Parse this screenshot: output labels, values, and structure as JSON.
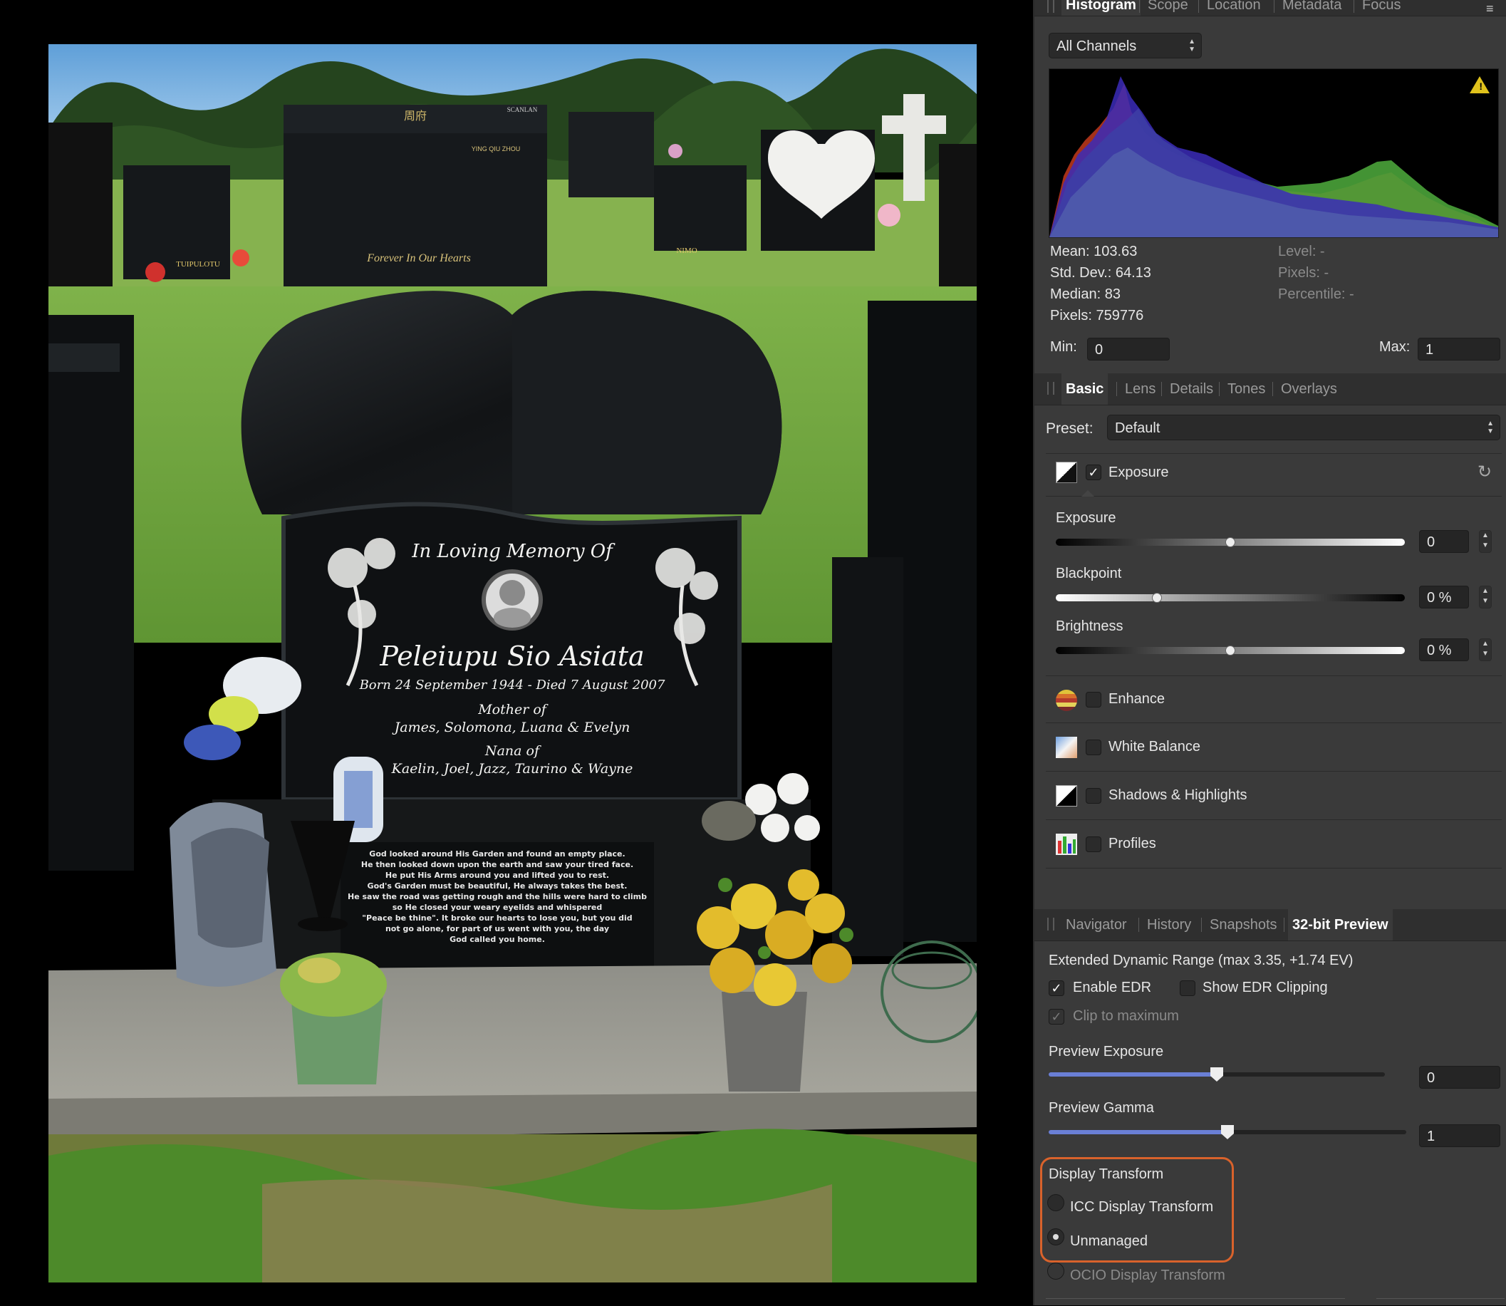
{
  "histogram_panel": {
    "tabs": [
      "Histogram",
      "Scope",
      "Location",
      "Metadata",
      "Focus"
    ],
    "active_tab": "Histogram",
    "channel_select": "All Channels",
    "stats": {
      "mean": "Mean: 103.63",
      "std_dev": "Std. Dev.: 64.13",
      "median": "Median: 83",
      "pixels": "Pixels: 759776",
      "level": "Level: -",
      "pixels_right": "Pixels: -",
      "percentile": "Percentile: -"
    },
    "min_label": "Min:",
    "min_value": "0",
    "max_label": "Max:",
    "max_value": "1"
  },
  "develop_panel": {
    "tabs": [
      "Basic",
      "Lens",
      "Details",
      "Tones",
      "Overlays"
    ],
    "active_tab": "Basic",
    "preset_label": "Preset:",
    "preset_value": "Default",
    "exposure_group": {
      "title": "Exposure",
      "enabled": true,
      "sliders": [
        {
          "label": "Exposure",
          "value": "0",
          "position": 0.5
        },
        {
          "label": "Blackpoint",
          "value": "0 %",
          "position": 0.29
        },
        {
          "label": "Brightness",
          "value": "0 %",
          "position": 0.5
        }
      ]
    },
    "groups": [
      {
        "title": "Enhance",
        "icon": "enhance-icon"
      },
      {
        "title": "White Balance",
        "icon": "white-balance-icon"
      },
      {
        "title": "Shadows & Highlights",
        "icon": "shadows-highlights-icon"
      },
      {
        "title": "Profiles",
        "icon": "profiles-icon"
      }
    ]
  },
  "preview_panel": {
    "tabs": [
      "Navigator",
      "History",
      "Snapshots",
      "32-bit Preview"
    ],
    "active_tab": "32-bit Preview",
    "edr_title": "Extended Dynamic Range (max 3.35, +1.74 EV)",
    "enable_edr": "Enable EDR",
    "show_edr_clipping": "Show EDR Clipping",
    "clip_to_maximum": "Clip to maximum",
    "preview_exposure_label": "Preview Exposure",
    "preview_exposure_value": "0",
    "preview_exposure_position": 0.5,
    "preview_gamma_label": "Preview Gamma",
    "preview_gamma_value": "1",
    "preview_gamma_position": 0.5,
    "display_transform_label": "Display Transform",
    "icc_display_transform": "ICC Display Transform",
    "unmanaged": "Unmanaged",
    "ocio_display_transform": "OCIO Display Transform",
    "highlight_color": "#d9622b"
  },
  "photo": {
    "header_text": "In Loving Memory Of",
    "name": "Peleiupu Sio Asiata",
    "dates": "Born 24 September 1944 - Died 7 August 2007",
    "mother_of": "Mother of",
    "children": "James, Solomona, Luana & Evelyn",
    "nana_of": "Nana of",
    "grandchildren": "Kaelin, Joel, Jazz, Taurino & Wayne",
    "poem": [
      "God looked around His Garden and found an empty place.",
      "He then looked down upon the earth and saw your tired face.",
      "He put His Arms around you and lifted you to rest.",
      "God's Garden must be beautiful, He always takes the best.",
      "He saw the road was getting rough and the hills were hard to climb",
      "so He closed your weary eyelids and whispered",
      "\"Peace be thine\". It broke our hearts to lose you, but you did",
      "not go alone, for part of us went with you, the day",
      "God called you home."
    ],
    "bg_labels": [
      "周府",
      "SCANLAN",
      "YING QIU ZHOU",
      "Forever In Our Hearts",
      "TUIPULOTU",
      "NIMO"
    ]
  }
}
